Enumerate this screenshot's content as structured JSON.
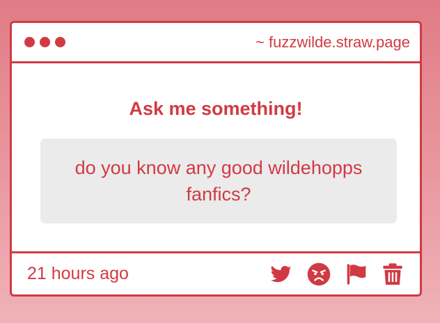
{
  "window": {
    "site": "~ fuzzwilde.straw.page"
  },
  "ask": {
    "heading": "Ask me something!",
    "question": "do you know any good wildehopps fanfics?"
  },
  "footer": {
    "time": "21 hours ago",
    "icons": [
      "twitter-icon",
      "angry-face-icon",
      "flag-icon",
      "trash-icon"
    ]
  },
  "colors": {
    "accent": "#d13a43",
    "question_bg": "#ebebeb"
  }
}
